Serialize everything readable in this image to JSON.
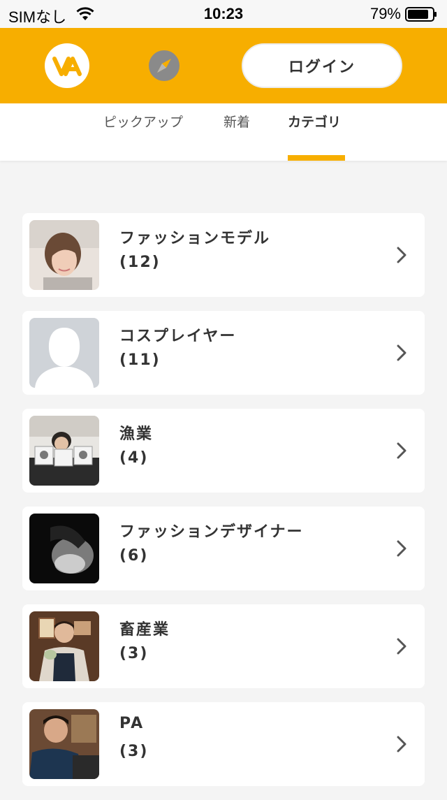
{
  "status_bar": {
    "carrier": "SIMなし",
    "time": "10:23",
    "battery": "79%"
  },
  "header": {
    "logo_text": "VA",
    "login_label": "ログイン",
    "colors": {
      "accent": "#f7ae00"
    }
  },
  "tabs": [
    {
      "label": "ピックアップ",
      "active": false
    },
    {
      "label": "新着",
      "active": false
    },
    {
      "label": "カテゴリ",
      "active": true
    }
  ],
  "categories": [
    {
      "name": "ファッションモデル",
      "count": "(12)",
      "thumb": "photo-woman"
    },
    {
      "name": "コスプレイヤー",
      "count": "(11)",
      "thumb": "placeholder-silhouette"
    },
    {
      "name": "漁業",
      "count": "(4)",
      "thumb": "photo-man-with-drawings"
    },
    {
      "name": "ファッションデザイナー",
      "count": "(6)",
      "thumb": "photo-monochrome-face"
    },
    {
      "name": "畜産業",
      "count": "(3)",
      "thumb": "photo-man-apron"
    },
    {
      "name": "PA",
      "count": "(3)",
      "thumb": "photo-man-navy-shirt"
    }
  ]
}
